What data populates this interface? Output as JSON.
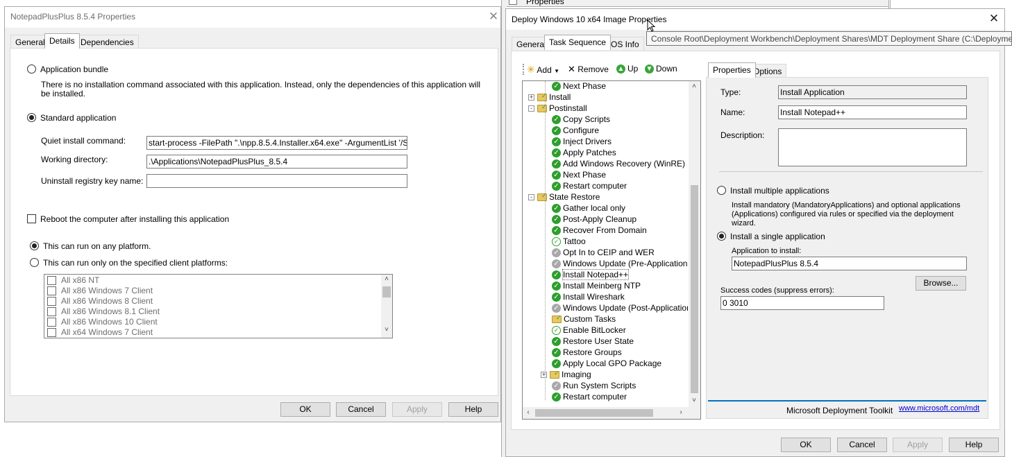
{
  "colors": {
    "window_bg": "#f0f0f0",
    "accent_blue": "#0070c0",
    "success_green": "#2e9e2e"
  },
  "bg_window": {
    "properties_label": "Properties"
  },
  "left_dialog": {
    "title": "NotepadPlusPlus 8.5.4 Properties",
    "tabs": [
      "General",
      "Details",
      "Dependencies"
    ],
    "active_tab": "Details",
    "application_bundle_label": "Application bundle",
    "bundle_desc_line1": "There is no installation command associated with this application.  Instead, only the dependencies of this application will",
    "bundle_desc_line2": "be installed.",
    "standard_application_label": "Standard application",
    "quiet_install_label": "Quiet install command:",
    "quiet_install_value": "start-process -FilePath \".\\npp.8.5.4.Installer.x64.exe\" -ArgumentList '/S' -Verb runAs",
    "working_dir_label": "Working directory:",
    "working_dir_value": ".\\Applications\\NotepadPlusPlus_8.5.4",
    "uninstall_key_label": "Uninstall registry key name:",
    "uninstall_key_value": "",
    "reboot_label": "Reboot the computer after installing this application",
    "any_platform_label": "This can run on any platform.",
    "specified_platform_label": "This can run only on the specified client platforms:",
    "platforms": [
      "All x86 NT",
      "All x86 Windows 7 Client",
      "All x86 Windows 8 Client",
      "All x86 Windows 8.1 Client",
      "All x86 Windows 10 Client",
      "All x64 Windows 7 Client"
    ],
    "buttons": {
      "ok": "OK",
      "cancel": "Cancel",
      "apply": "Apply",
      "help": "Help"
    }
  },
  "right_dialog": {
    "title": "Deploy Windows 10 x64 Image Properties",
    "tabs": [
      "General",
      "Task Sequence",
      "OS Info"
    ],
    "active_tab": "Task Sequence",
    "tooltip": "Console Root\\Deployment Workbench\\Deployment Shares\\MDT Deployment Share (C:\\Deployment",
    "toolbar": {
      "add": "Add",
      "remove": "Remove",
      "up": "Up",
      "down": "Down"
    },
    "tree": [
      {
        "label": "Next Phase",
        "icon": "ok",
        "level": 2
      },
      {
        "label": "Install",
        "icon": "folder",
        "level": 1,
        "expander": "+"
      },
      {
        "label": "Postinstall",
        "icon": "folder",
        "level": 1,
        "expander": "-"
      },
      {
        "label": "Copy Scripts",
        "icon": "ok",
        "level": 2
      },
      {
        "label": "Configure",
        "icon": "ok",
        "level": 2
      },
      {
        "label": "Inject Drivers",
        "icon": "ok",
        "level": 2
      },
      {
        "label": "Apply Patches",
        "icon": "ok",
        "level": 2
      },
      {
        "label": "Add Windows Recovery (WinRE)",
        "icon": "ok",
        "level": 2
      },
      {
        "label": "Next Phase",
        "icon": "ok",
        "level": 2
      },
      {
        "label": "Restart computer",
        "icon": "ok",
        "level": 2
      },
      {
        "label": "State Restore",
        "icon": "folder",
        "level": 1,
        "expander": "-"
      },
      {
        "label": "Gather local only",
        "icon": "ok",
        "level": 2
      },
      {
        "label": "Post-Apply Cleanup",
        "icon": "ok",
        "level": 2
      },
      {
        "label": "Recover From Domain",
        "icon": "ok",
        "level": 2
      },
      {
        "label": "Tattoo",
        "icon": "lite",
        "level": 2
      },
      {
        "label": "Opt In to CEIP and WER",
        "icon": "disabled",
        "level": 2
      },
      {
        "label": "Windows Update (Pre-Application Inst",
        "icon": "disabled",
        "level": 2
      },
      {
        "label": "Install Notepad++",
        "icon": "ok",
        "level": 2,
        "selected": true
      },
      {
        "label": "Install Meinberg NTP",
        "icon": "ok",
        "level": 2
      },
      {
        "label": "Install Wireshark",
        "icon": "ok",
        "level": 2
      },
      {
        "label": "Windows Update (Post-Application Ins",
        "icon": "disabled",
        "level": 2
      },
      {
        "label": "Custom Tasks",
        "icon": "folder",
        "level": 2
      },
      {
        "label": "Enable BitLocker",
        "icon": "lite",
        "level": 2
      },
      {
        "label": "Restore User State",
        "icon": "ok",
        "level": 2
      },
      {
        "label": "Restore Groups",
        "icon": "ok",
        "level": 2
      },
      {
        "label": "Apply Local GPO Package",
        "icon": "ok",
        "level": 2
      },
      {
        "label": "Imaging",
        "icon": "folder",
        "level": 2,
        "expander": "+"
      },
      {
        "label": "Run System Scripts",
        "icon": "disabled",
        "level": 2
      },
      {
        "label": "Restart computer",
        "icon": "ok",
        "level": 2
      }
    ],
    "props_tabs": [
      "Properties",
      "Options"
    ],
    "type_label": "Type:",
    "type_value": "Install Application",
    "name_label": "Name:",
    "name_value": "Install Notepad++",
    "description_label": "Description:",
    "description_value": "",
    "install_multiple_label": "Install multiple applications",
    "multiple_desc_line1": "Install mandatory (MandatoryApplications) and optional applications",
    "multiple_desc_line2": "(Applications) configured via rules or specified via the deployment",
    "multiple_desc_line3": "wizard.",
    "install_single_label": "Install a single application",
    "app_to_install_label": "Application to install:",
    "app_to_install_value": "NotepadPlusPlus 8.5.4",
    "browse_label": "Browse...",
    "success_codes_label": "Success codes (suppress errors):",
    "success_codes_value": "0 3010",
    "footer_brand": "Microsoft Deployment Toolkit",
    "footer_link": "www.microsoft.com/mdt",
    "buttons": {
      "ok": "OK",
      "cancel": "Cancel",
      "apply": "Apply",
      "help": "Help"
    }
  }
}
